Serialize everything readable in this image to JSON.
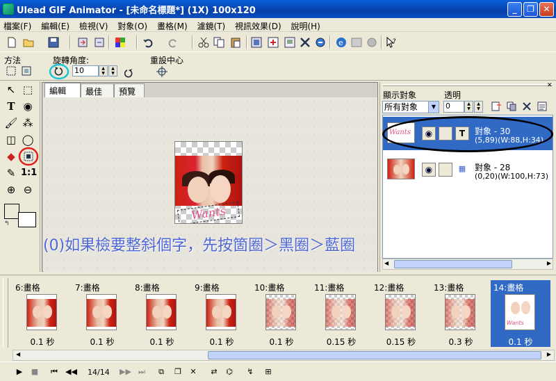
{
  "window": {
    "title": "Ulead GIF Animator - [未命名標題*] (1X) 100x120",
    "minimize": "_",
    "restore": "❐",
    "close": "✕"
  },
  "menu": [
    "檔案(F)",
    "編輯(E)",
    "檢視(V)",
    "對象(O)",
    "畫格(M)",
    "濾鏡(T)",
    "視訊效果(D)",
    "說明(H)"
  ],
  "propbar": {
    "method_label": "方法",
    "rotate_label": "旋轉角度:",
    "rotate_value": "10",
    "reset_center_label": "重設中心"
  },
  "tabs": [
    "編輯",
    "最佳化",
    "預覽"
  ],
  "tools": {
    "ratio_label": "1:1"
  },
  "canvas": {
    "text_object": "Wants",
    "instruction": "(0)如果檢要整斜個字，先按箇圈＞黑圈＞藍圈"
  },
  "object_panel": {
    "show_label": "顯示對象",
    "show_value": "所有對象",
    "opacity_label": "透明",
    "opacity_value": "0",
    "objects": [
      {
        "name": "對象 - 30",
        "info": "(5,89)(W:88,H:34)",
        "type": "T",
        "selected": true
      },
      {
        "name": "對象 - 28",
        "info": "(0,20)(W:100,H:73)",
        "type": "▦",
        "selected": false
      }
    ]
  },
  "frames": [
    {
      "label": "6:畫格",
      "delay": "0.1 秒",
      "style": "full"
    },
    {
      "label": "7:畫格",
      "delay": "0.1 秒",
      "style": "full"
    },
    {
      "label": "8:畫格",
      "delay": "0.1 秒",
      "style": "full"
    },
    {
      "label": "9:畫格",
      "delay": "0.1 秒",
      "style": "full"
    },
    {
      "label": "10:畫格",
      "delay": "0.1 秒",
      "style": "fade"
    },
    {
      "label": "11:畫格",
      "delay": "0.15 秒",
      "style": "fade"
    },
    {
      "label": "12:畫格",
      "delay": "0.15 秒",
      "style": "fade"
    },
    {
      "label": "13:畫格",
      "delay": "0.3 秒",
      "style": "fade"
    },
    {
      "label": "14:畫格",
      "delay": "0.1 秒",
      "style": "selected"
    }
  ],
  "playbar": {
    "frame_counter": "14/14"
  },
  "colors": {
    "selection": "#316ac5",
    "instruction_text": "#4f67d4",
    "highlight_circle_cyan": "#19c4d4",
    "highlight_circle_red": "#e0201a"
  }
}
